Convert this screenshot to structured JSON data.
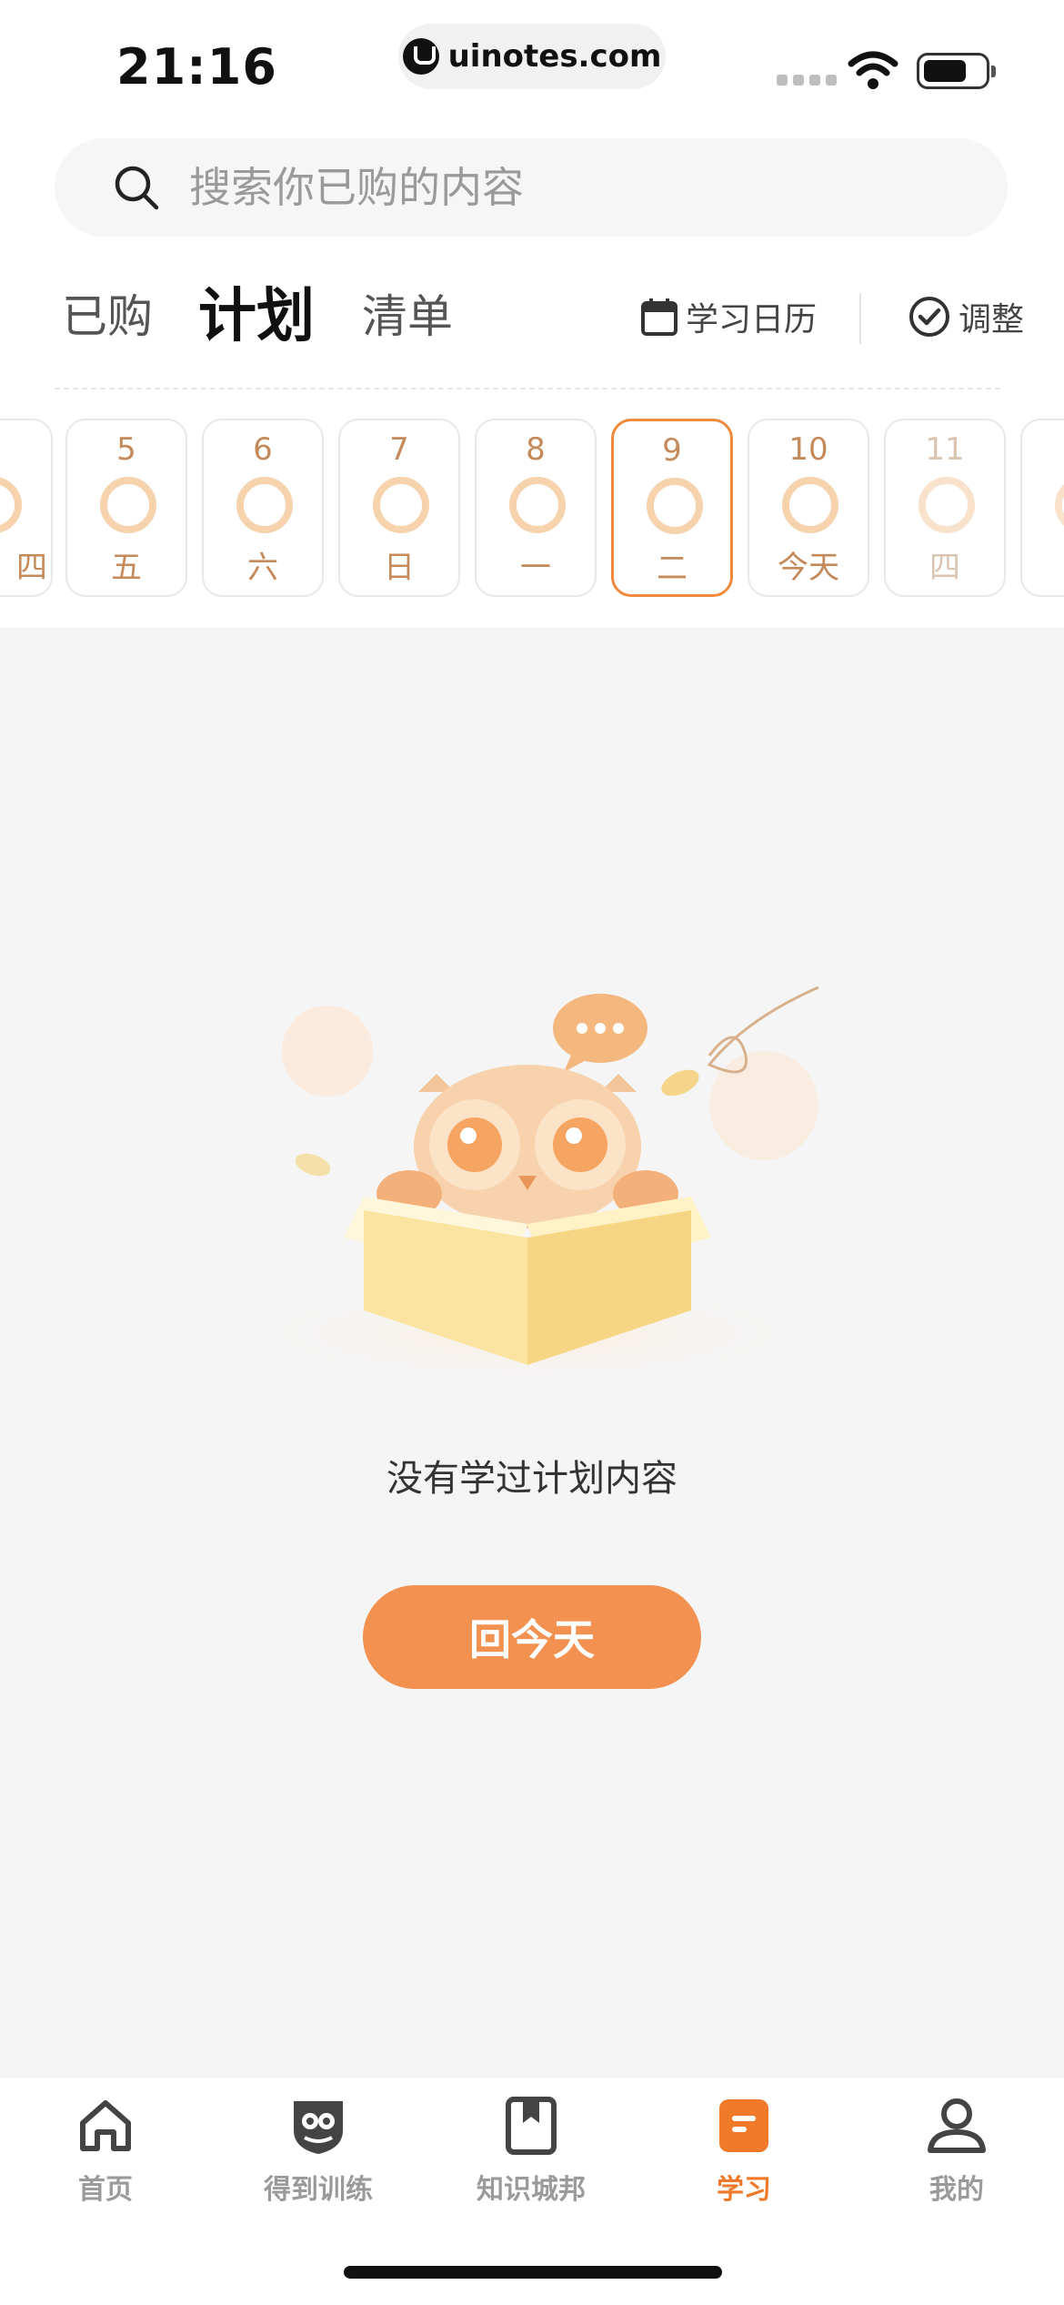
{
  "status_bar": {
    "time": "21:16",
    "url": "uinotes.com"
  },
  "search": {
    "placeholder": "搜索你已购的内容"
  },
  "tabs": [
    {
      "label": "已购",
      "active": false
    },
    {
      "label": "计划",
      "active": true
    },
    {
      "label": "清单",
      "active": false
    }
  ],
  "tools": {
    "calendar": "学习日历",
    "adjust": "调整"
  },
  "days": [
    {
      "num": "",
      "week": "四"
    },
    {
      "num": "5",
      "week": "五"
    },
    {
      "num": "6",
      "week": "六"
    },
    {
      "num": "7",
      "week": "日"
    },
    {
      "num": "8",
      "week": "一"
    },
    {
      "num": "9",
      "week": "二",
      "selected": true
    },
    {
      "num": "10",
      "week": "今天"
    },
    {
      "num": "11",
      "week": "四",
      "future": true
    },
    {
      "num": "",
      "week": ""
    }
  ],
  "empty": {
    "message": "没有学过计划内容",
    "button": "回今天"
  },
  "bottom_nav": [
    {
      "label": "首页",
      "icon": "home-icon"
    },
    {
      "label": "得到训练",
      "icon": "owl-shield-icon"
    },
    {
      "label": "知识城邦",
      "icon": "bookmark-book-icon"
    },
    {
      "label": "学习",
      "icon": "study-icon",
      "active": true
    },
    {
      "label": "我的",
      "icon": "profile-icon"
    }
  ],
  "colors": {
    "accent": "#f29150",
    "accent_dark": "#f07a2a",
    "ring": "#f6d2ad"
  }
}
